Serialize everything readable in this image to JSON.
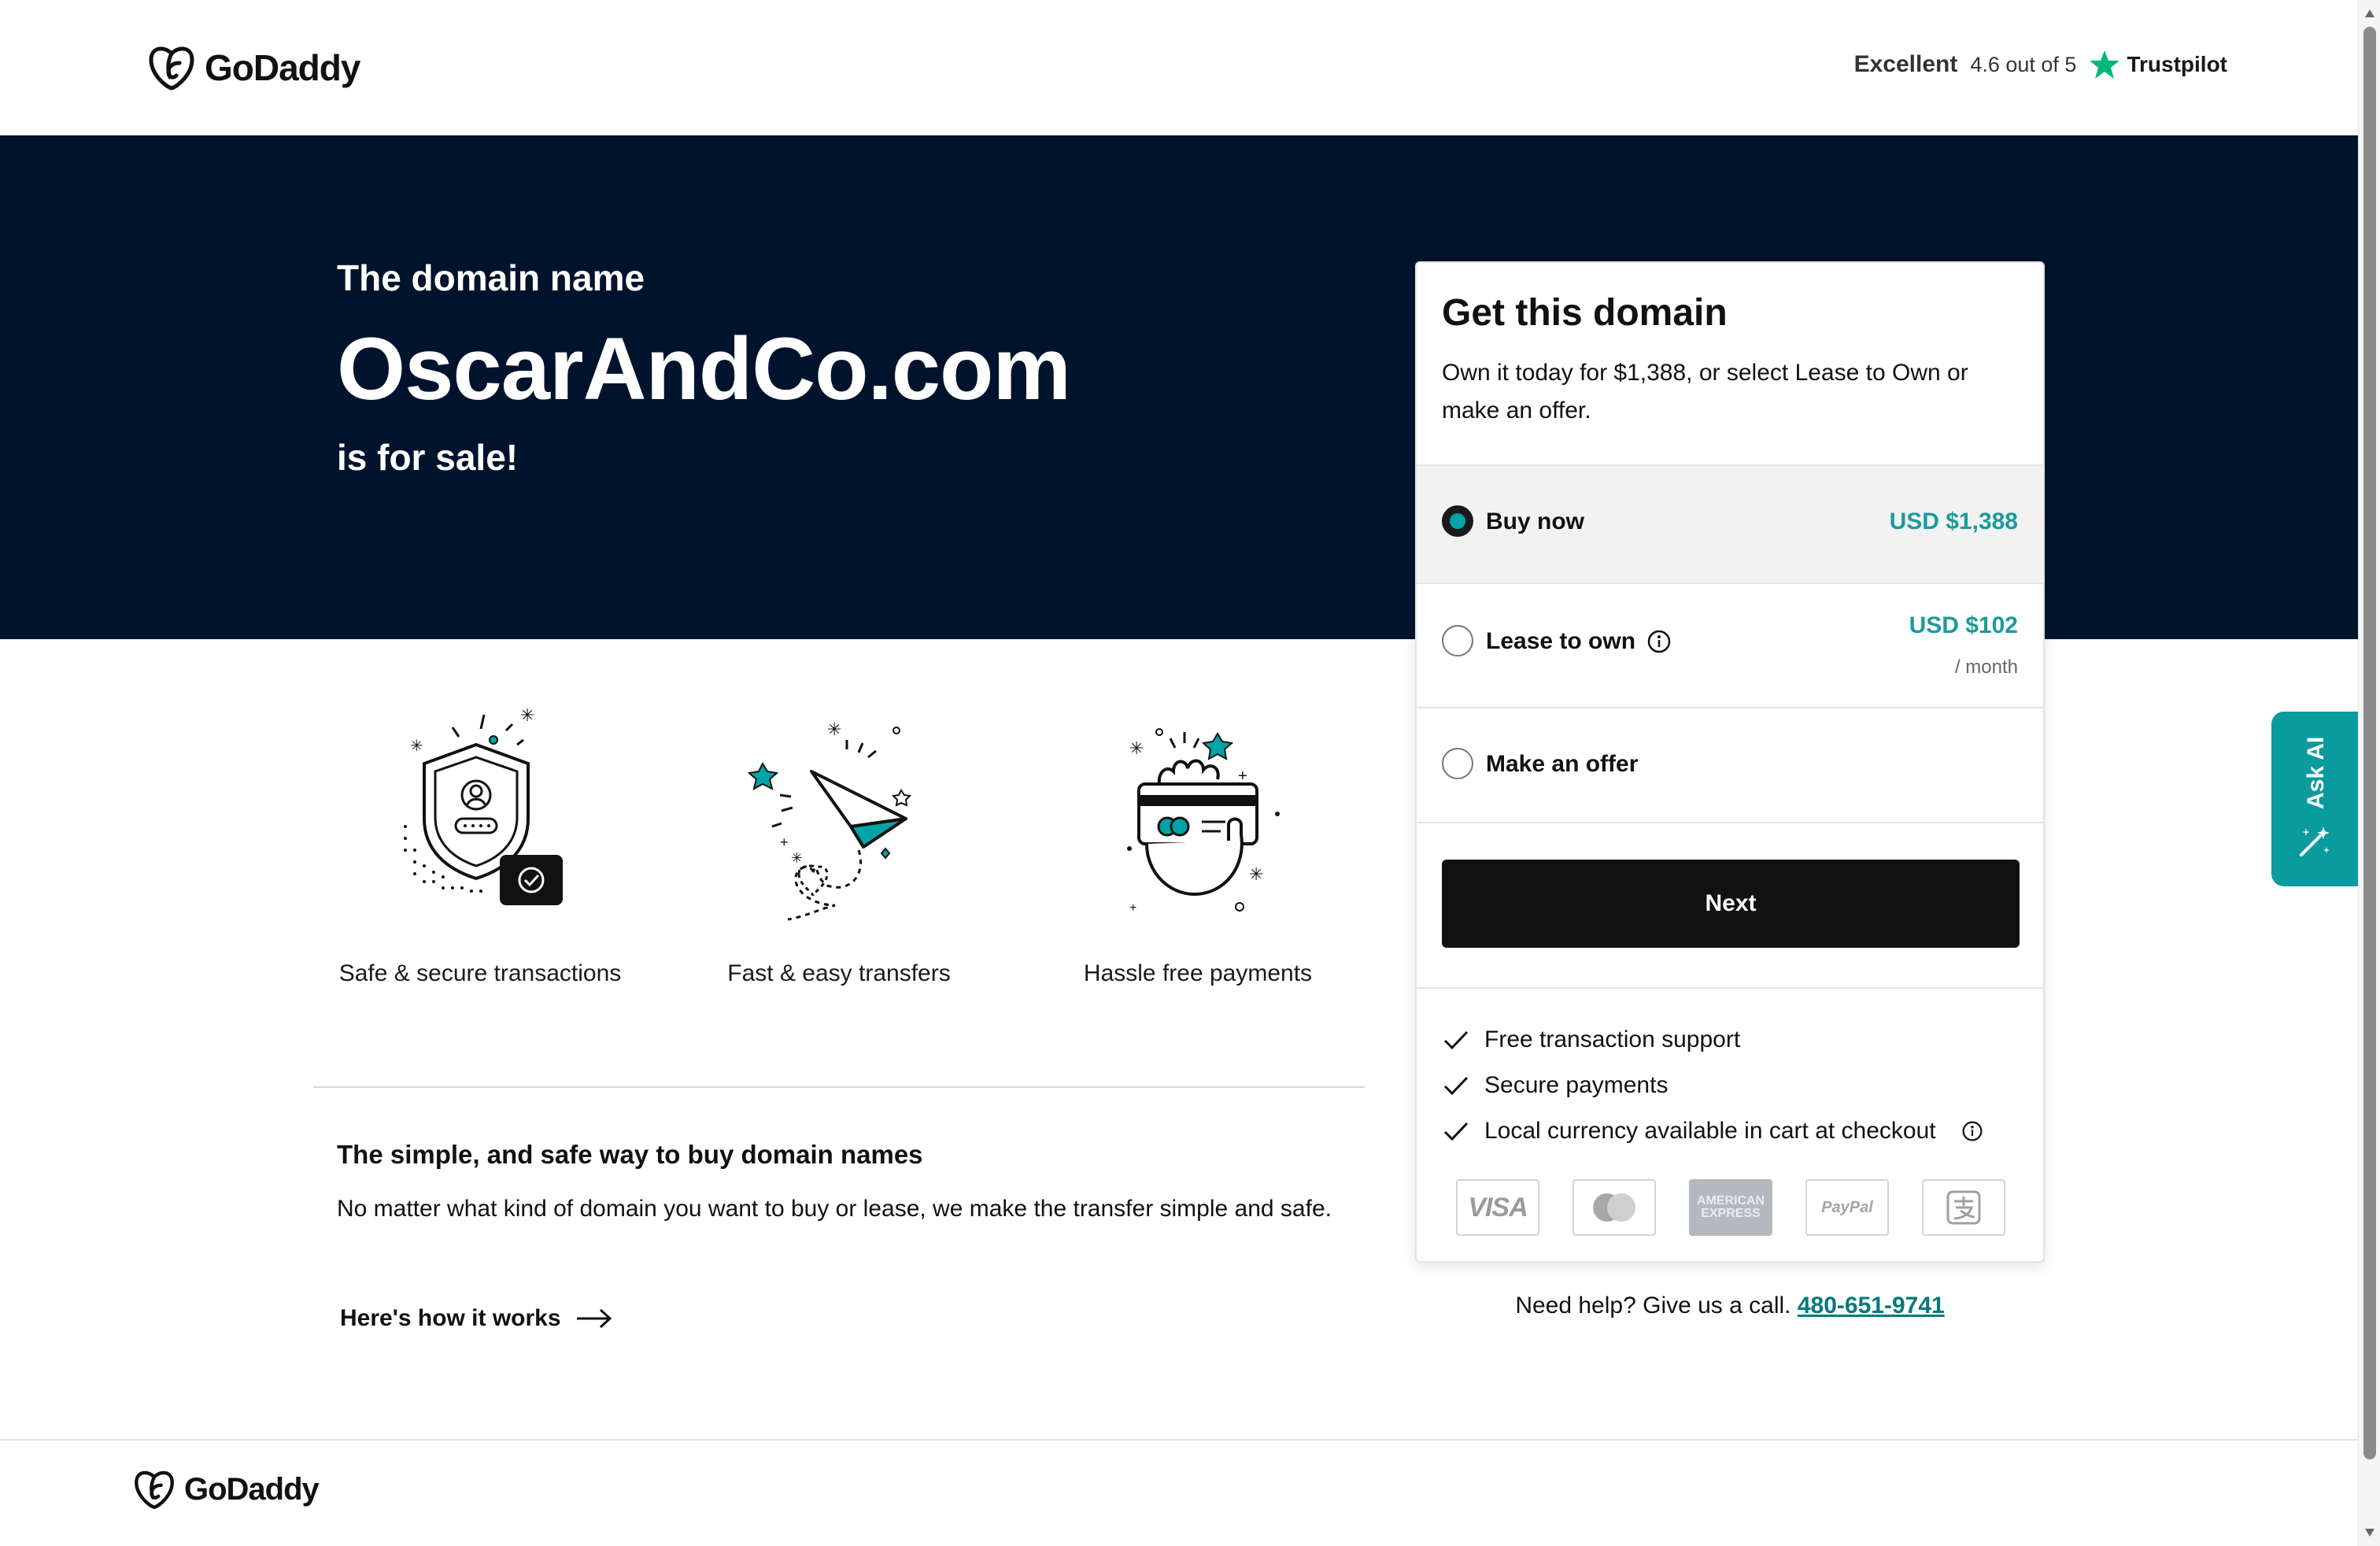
{
  "header": {
    "brand": "GoDaddy",
    "trustpilot": {
      "rating_word": "Excellent",
      "score": "4.6 out of 5",
      "brand": "Trustpilot"
    }
  },
  "hero": {
    "pre": "The domain name",
    "domain": "OscarAndCo.com",
    "post": "is for sale!"
  },
  "features": [
    {
      "icon": "shield-icon",
      "caption": "Safe & secure transactions"
    },
    {
      "icon": "paper-plane-icon",
      "caption": "Fast & easy transfers"
    },
    {
      "icon": "card-hand-icon",
      "caption": "Hassle free payments"
    }
  ],
  "info": {
    "heading": "The simple, and safe way to buy domain names",
    "body": "No matter what kind of domain you want to buy or lease, we make the transfer simple and safe.",
    "link": "Here's how it works"
  },
  "card": {
    "title": "Get this domain",
    "description": "Own it today for $1,388, or select Lease to Own or make an offer.",
    "options": [
      {
        "label": "Buy now",
        "price": "USD $1,388",
        "selected": true
      },
      {
        "label": "Lease to own",
        "price": "USD $102",
        "per": "/ month",
        "selected": false
      },
      {
        "label": "Make an offer",
        "selected": false
      }
    ],
    "next_label": "Next",
    "checks": [
      "Free transaction support",
      "Secure payments",
      "Local currency available in cart at checkout"
    ],
    "payments": [
      "VISA",
      "mastercard",
      "AMERICAN EXPRESS",
      "PayPal",
      "alipay"
    ]
  },
  "help": {
    "text": "Need help? Give us a call.",
    "phone": "480-651-9741"
  },
  "ask_ai": "Ask AI",
  "footer": {
    "brand": "GoDaddy"
  },
  "colors": {
    "hero_bg": "#00132d",
    "accent": "#00a4a6",
    "price": "#1b9b9c",
    "button": "#111111"
  }
}
